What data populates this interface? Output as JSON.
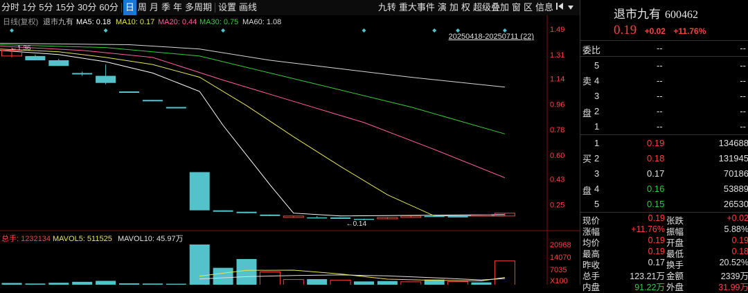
{
  "toolbar": {
    "left": [
      {
        "label": "分时",
        "active": false
      },
      {
        "label": "1分",
        "active": false
      },
      {
        "label": "5分",
        "active": false
      },
      {
        "label": "15分",
        "active": false
      },
      {
        "label": "30分",
        "active": false
      },
      {
        "label": "60分",
        "active": false
      },
      {
        "label": "日",
        "active": true
      },
      {
        "label": "周",
        "active": false
      },
      {
        "label": "月",
        "active": false
      },
      {
        "label": "季",
        "active": false
      },
      {
        "label": "年",
        "active": false
      },
      {
        "label": "多周期",
        "active": false
      },
      {
        "label": "设置",
        "active": false
      },
      {
        "label": "画线",
        "active": false
      }
    ],
    "right": [
      "九转",
      "重大事件",
      "演",
      "加",
      "权",
      "超级叠加",
      "窗",
      "区",
      "信息"
    ],
    "pin_icon": "pin-icon",
    "dropdown_icon": "chevron-down-icon"
  },
  "ma_legend": {
    "period_label": "日线(复权)",
    "stock_name": "退市九有",
    "items": [
      {
        "label": "MA5: 0.18",
        "color": "#ffffff"
      },
      {
        "label": "MA10: 0.17",
        "color": "#e6e65a"
      },
      {
        "label": "MA20: 0.44",
        "color": "#ff5fa0"
      },
      {
        "label": "MA30: 0.75",
        "color": "#3ccc3c"
      },
      {
        "label": "MA60: 1.08",
        "color": "#d8d8d8"
      }
    ]
  },
  "chart_data": {
    "type": "candlestick",
    "range_label": "20250418-20250711 (22)",
    "y_ticks": [
      "1.49",
      "1.31",
      "1.14",
      "0.96",
      "0.78",
      "0.60",
      "0.43",
      "0.25"
    ],
    "y_range": [
      0.13,
      1.5
    ],
    "high_annotation": "1.36",
    "low_annotation": "0.14",
    "candles": [
      {
        "o": 1.3,
        "h": 1.36,
        "l": 1.29,
        "c": 1.34
      },
      {
        "o": 1.3,
        "h": 1.31,
        "l": 1.27,
        "c": 1.27
      },
      {
        "o": 1.27,
        "h": 1.28,
        "l": 1.23,
        "c": 1.23
      },
      {
        "o": 1.18,
        "h": 1.19,
        "l": 1.16,
        "c": 1.17
      },
      {
        "o": 1.16,
        "h": 1.24,
        "l": 1.1,
        "c": 1.11
      },
      {
        "o": 1.05,
        "h": 1.05,
        "l": 1.04,
        "c": 1.04
      },
      {
        "o": 0.99,
        "h": 0.99,
        "l": 0.98,
        "c": 0.98
      },
      {
        "o": 0.94,
        "h": 0.94,
        "l": 0.93,
        "c": 0.93
      },
      {
        "o": 0.48,
        "h": 0.48,
        "l": 0.21,
        "c": 0.21
      },
      {
        "o": 0.21,
        "h": 0.21,
        "l": 0.2,
        "c": 0.2
      },
      {
        "o": 0.2,
        "h": 0.2,
        "l": 0.19,
        "c": 0.19
      },
      {
        "o": 0.18,
        "h": 0.18,
        "l": 0.17,
        "c": 0.17
      },
      {
        "o": 0.16,
        "h": 0.17,
        "l": 0.16,
        "c": 0.17
      },
      {
        "o": 0.16,
        "h": 0.17,
        "l": 0.16,
        "c": 0.16
      },
      {
        "o": 0.16,
        "h": 0.16,
        "l": 0.15,
        "c": 0.15
      },
      {
        "o": 0.15,
        "h": 0.15,
        "l": 0.14,
        "c": 0.15
      },
      {
        "o": 0.15,
        "h": 0.16,
        "l": 0.15,
        "c": 0.16
      },
      {
        "o": 0.16,
        "h": 0.17,
        "l": 0.16,
        "c": 0.17
      },
      {
        "o": 0.17,
        "h": 0.18,
        "l": 0.17,
        "c": 0.17
      },
      {
        "o": 0.17,
        "h": 0.17,
        "l": 0.16,
        "c": 0.16
      },
      {
        "o": 0.17,
        "h": 0.18,
        "l": 0.17,
        "c": 0.18
      },
      {
        "o": 0.17,
        "h": 0.19,
        "l": 0.17,
        "c": 0.19
      }
    ],
    "event_markers_at_index": [
      0,
      4,
      9,
      15,
      18,
      19,
      21
    ],
    "ma_series": [
      {
        "name": "MA5",
        "color": "#ffffff",
        "points": [
          [
            -0.5,
            1.34
          ],
          [
            2,
            1.31
          ],
          [
            4,
            1.26
          ],
          [
            6,
            1.18
          ],
          [
            8,
            1.05
          ],
          [
            9,
            0.81
          ],
          [
            10,
            0.6
          ],
          [
            11,
            0.39
          ],
          [
            12,
            0.19
          ],
          [
            14,
            0.17
          ],
          [
            21,
            0.18
          ]
        ]
      },
      {
        "name": "MA10",
        "color": "#e6e65a",
        "points": [
          [
            -0.5,
            1.35
          ],
          [
            2,
            1.33
          ],
          [
            4,
            1.29
          ],
          [
            6,
            1.24
          ],
          [
            8,
            1.15
          ],
          [
            10,
            0.95
          ],
          [
            12,
            0.73
          ],
          [
            14,
            0.52
          ],
          [
            16,
            0.32
          ],
          [
            18,
            0.17
          ],
          [
            21,
            0.17
          ]
        ]
      },
      {
        "name": "MA20",
        "color": "#ff5fa0",
        "points": [
          [
            -0.5,
            1.37
          ],
          [
            3,
            1.34
          ],
          [
            6,
            1.29
          ],
          [
            9,
            1.13
          ],
          [
            12,
            0.98
          ],
          [
            15,
            0.83
          ],
          [
            18,
            0.64
          ],
          [
            21,
            0.44
          ]
        ]
      },
      {
        "name": "MA30",
        "color": "#3ccc3c",
        "points": [
          [
            -0.5,
            1.38
          ],
          [
            4,
            1.36
          ],
          [
            8,
            1.3
          ],
          [
            11,
            1.18
          ],
          [
            14,
            1.06
          ],
          [
            17,
            0.94
          ],
          [
            21,
            0.75
          ]
        ]
      },
      {
        "name": "MA60",
        "color": "#d8d8d8",
        "points": [
          [
            -0.5,
            1.39
          ],
          [
            5,
            1.38
          ],
          [
            8,
            1.35
          ],
          [
            11,
            1.27
          ],
          [
            14,
            1.21
          ],
          [
            17,
            1.15
          ],
          [
            21,
            1.08
          ]
        ]
      }
    ],
    "volume": {
      "legend": {
        "total": "总手: 1232134",
        "mavol5": "MAVOL5: 511525",
        "mavol10": "MAVOL10: 45.97万"
      },
      "y_ticks": [
        "20968",
        "14070",
        "7035",
        "X100"
      ],
      "max": 20968,
      "bars": [
        {
          "v": 900,
          "up": false
        },
        {
          "v": 600,
          "up": false
        },
        {
          "v": 1000,
          "up": false
        },
        {
          "v": 1500,
          "up": false
        },
        {
          "v": 2000,
          "up": false
        },
        {
          "v": 700,
          "up": false
        },
        {
          "v": 600,
          "up": false
        },
        {
          "v": 500,
          "up": false
        },
        {
          "v": 20968,
          "up": false
        },
        {
          "v": 8800,
          "up": false
        },
        {
          "v": 13400,
          "up": false
        },
        {
          "v": 6700,
          "up": true
        },
        {
          "v": 2700,
          "up": true
        },
        {
          "v": 2900,
          "up": false
        },
        {
          "v": 2400,
          "up": true
        },
        {
          "v": 1700,
          "up": false
        },
        {
          "v": 1900,
          "up": false
        },
        {
          "v": 1500,
          "up": true
        },
        {
          "v": 2700,
          "up": false
        },
        {
          "v": 1600,
          "up": true
        },
        {
          "v": 1200,
          "up": false
        },
        {
          "v": 12400,
          "up": true
        }
      ],
      "mavol5": [
        [
          8,
          4500
        ],
        [
          9,
          6000
        ],
        [
          10,
          7500
        ],
        [
          12,
          7600
        ],
        [
          14,
          5600
        ],
        [
          16,
          2900
        ],
        [
          18,
          2300
        ],
        [
          20,
          2000
        ],
        [
          21,
          3800
        ]
      ],
      "mavol10": [
        [
          8,
          3000
        ],
        [
          10,
          4200
        ],
        [
          12,
          4800
        ],
        [
          14,
          5100
        ],
        [
          16,
          4600
        ],
        [
          18,
          3600
        ],
        [
          20,
          2500
        ],
        [
          21,
          3200
        ]
      ]
    }
  },
  "quote": {
    "name": "退市九有",
    "code": "600462",
    "price": "0.19",
    "change": "+0.02",
    "change_pct": "+11.76%",
    "weibi_label": "委比",
    "weibi_val1": "--",
    "weibi_val2": "--",
    "sell_side_label": [
      "卖",
      "盘"
    ],
    "buy_side_label": [
      "买",
      "盘"
    ],
    "sell": [
      {
        "level": "5",
        "price": "--",
        "vol": "--"
      },
      {
        "level": "4",
        "price": "--",
        "vol": "--"
      },
      {
        "level": "3",
        "price": "--",
        "vol": "--"
      },
      {
        "level": "2",
        "price": "--",
        "vol": "--"
      },
      {
        "level": "1",
        "price": "--",
        "vol": "--"
      }
    ],
    "buy": [
      {
        "level": "1",
        "price": "0.19",
        "vol": "134688",
        "color": "red"
      },
      {
        "level": "2",
        "price": "0.18",
        "vol": "131945",
        "color": "red"
      },
      {
        "level": "3",
        "price": "0.17",
        "vol": "70186",
        "color": "white"
      },
      {
        "level": "4",
        "price": "0.16",
        "vol": "53889",
        "color": "green"
      },
      {
        "level": "5",
        "price": "0.15",
        "vol": "26530",
        "color": "green"
      }
    ],
    "stats": [
      {
        "l1": "现价",
        "v1": "0.19",
        "c1": "red",
        "l2": "张跌",
        "v2": "+0.02",
        "c2": "red"
      },
      {
        "l1": "涨幅",
        "v1": "+11.76%",
        "c1": "red",
        "l2": "振幅",
        "v2": "5.88%",
        "c2": "white"
      },
      {
        "l1": "均价",
        "v1": "0.19",
        "c1": "red",
        "l2": "开盘",
        "v2": "0.19",
        "c2": "red"
      },
      {
        "l1": "最高",
        "v1": "0.19",
        "c1": "red",
        "l2": "最低",
        "v2": "0.18",
        "c2": "red"
      },
      {
        "l1": "昨收",
        "v1": "0.17",
        "c1": "white",
        "l2": "换手",
        "v2": "20.52%",
        "c2": "white"
      },
      {
        "l1": "总手",
        "v1": "123.21万",
        "c1": "white",
        "l2": "金额",
        "v2": "2339万",
        "c2": "white"
      },
      {
        "l1": "内盘",
        "v1": "91.22万",
        "c1": "green",
        "l2": "外盘",
        "v2": "31.99万",
        "c2": "red"
      }
    ]
  }
}
